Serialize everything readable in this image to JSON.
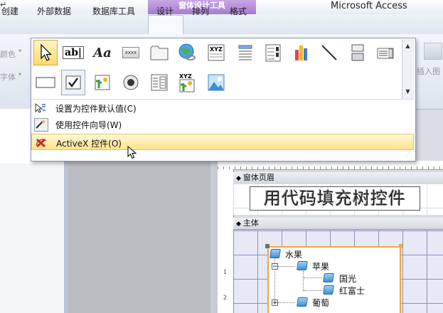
{
  "window": {
    "title": "Microsoft Access",
    "context_tab_group": "窗体设计工具"
  },
  "tabs": [
    {
      "label": "创建"
    },
    {
      "label": "外部数据"
    },
    {
      "label": "数据库工具"
    },
    {
      "label": "设计"
    },
    {
      "label": "排列"
    },
    {
      "label": "格式"
    }
  ],
  "ribbon": {
    "left_labels": [
      "颜色",
      "字体"
    ],
    "insert_image_label": "插入图"
  },
  "gallery": {
    "row1_tools": [
      "select-tool",
      "textbox-tool",
      "label-tool",
      "button-tool",
      "tab-control-tool",
      "hyperlink-tool",
      "web-browser-tool",
      "navigation-tool",
      "option-group-tool",
      "chart-tool",
      "line-tool",
      "toggle-button-tool",
      "list-box-tool"
    ],
    "row2_tools": [
      "rectangle-tool",
      "checkbox-tool",
      "unbound-object-tool",
      "option-button-tool",
      "subform-tool",
      "bound-object-tool",
      "image-tool"
    ],
    "textbox_glyph": "ab|",
    "label_glyph": "Aa",
    "button_glyph": "xxxx",
    "xyz_glyph": "XYZ"
  },
  "menu": {
    "items": [
      {
        "label": "设置为控件默认值(C)",
        "icon": "set-default-icon"
      },
      {
        "label": "使用控件向导(W)",
        "icon": "wizard-icon"
      },
      {
        "label": "ActiveX 控件(O)",
        "icon": "activex-icon",
        "highlighted": true
      }
    ]
  },
  "form": {
    "header_section": "窗体页眉",
    "header_label": "用代码填充树控件",
    "detail_section": "主体",
    "ruler_marks": [
      "1",
      "2"
    ]
  },
  "tree": {
    "nodes": [
      {
        "label": "水果",
        "level": 0,
        "expander": ""
      },
      {
        "label": "苹果",
        "level": 1,
        "expander": "−"
      },
      {
        "label": "国光",
        "level": 2,
        "expander": ""
      },
      {
        "label": "红富士",
        "level": 2,
        "expander": ""
      },
      {
        "label": "葡萄",
        "level": 1,
        "expander": "+"
      }
    ]
  },
  "colors": {
    "accent_purple": "#a47ad1",
    "highlight": "#ffe28a",
    "selection_border": "#f2a540"
  }
}
